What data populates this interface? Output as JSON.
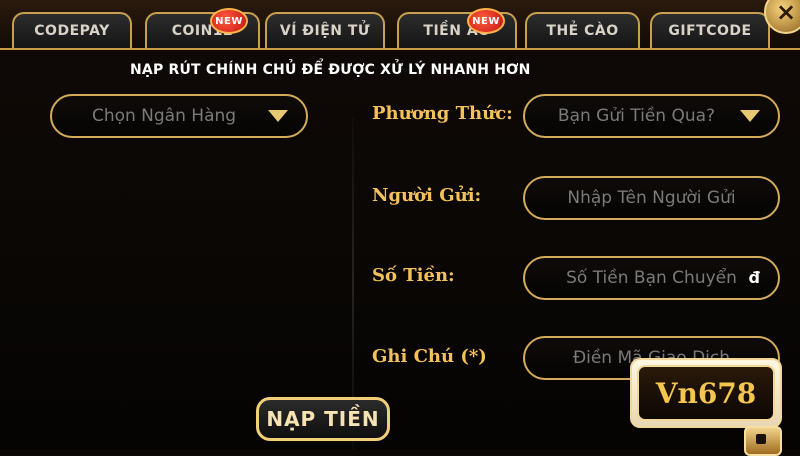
{
  "tabs": [
    {
      "label": "CODEPAY",
      "active": true,
      "badge": ""
    },
    {
      "label": "COIN12",
      "active": false,
      "badge": "NEW"
    },
    {
      "label": "VÍ ĐIỆN TỬ",
      "active": false,
      "badge": ""
    },
    {
      "label": "TIỀN ẢO",
      "active": false,
      "badge": "NEW"
    },
    {
      "label": "THẺ CÀO",
      "active": false,
      "badge": ""
    },
    {
      "label": "GIFTCODE",
      "active": false,
      "badge": ""
    }
  ],
  "notice": "NẠP RÚT CHÍNH CHỦ ĐỂ ĐƯỢC XỬ LÝ NHANH HƠN",
  "left": {
    "bank_select_placeholder": "Chọn Ngân Hàng"
  },
  "form": {
    "method_label": "Phương Thức:",
    "method_placeholder": "Bạn Gửi Tiền Qua?",
    "sender_label": "Người Gửi:",
    "sender_placeholder": "Nhập Tên Người Gửi",
    "amount_label": "Số Tiền:",
    "amount_placeholder": "Số Tiền Bạn Chuyển",
    "currency_symbol": "đ",
    "note_label": "Ghi Chú (*)",
    "note_placeholder": "Điền Mã Giao Dịch"
  },
  "deposit_button_label": "NẠP TIỀN",
  "logo_text": "Vn678",
  "colors": {
    "gold": "#d3ab5b",
    "gold_text": "#f3c15a",
    "background": "#050403",
    "badge_red": "#c2150f"
  }
}
